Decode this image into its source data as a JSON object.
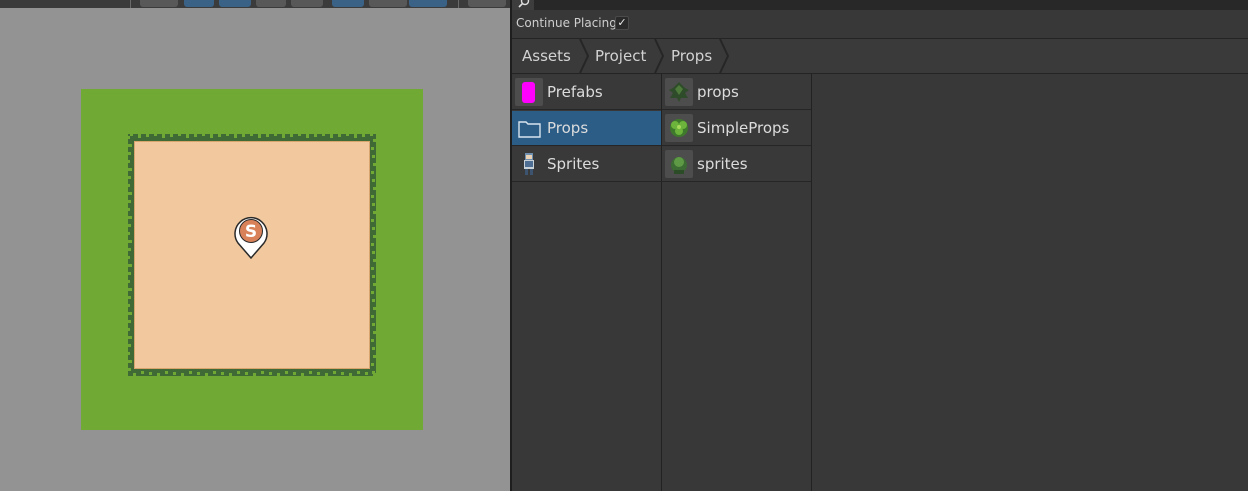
{
  "scene": {
    "toolbar_icons": [
      "globe-icon",
      "layers-icon",
      "move-tool-icon",
      "star-icon",
      "shape-icon",
      "chat-icon",
      "view-icon",
      "gizmo-icon",
      "settings-icon"
    ],
    "pin_letter": "S",
    "colors": {
      "background": "#939393",
      "grass": "#70a934",
      "sand": "#f2c99f",
      "border": "#3f6a35"
    }
  },
  "panel": {
    "search_icon": "search-icon",
    "continue_placing": {
      "label": "Continue Placing",
      "checked": true,
      "check_glyph": "✓"
    },
    "breadcrumb": [
      "Assets",
      "Project",
      "Props"
    ],
    "column1": [
      {
        "label": "Prefabs",
        "icon": "prefab-icon",
        "selected": false
      },
      {
        "label": "Props",
        "icon": "folder-icon",
        "selected": true
      },
      {
        "label": "Sprites",
        "icon": "character-sprite-icon",
        "selected": false
      }
    ],
    "column2": [
      {
        "label": "props",
        "icon": "tree-sprite-icon"
      },
      {
        "label": "SimpleProps",
        "icon": "bush-sprite-icon"
      },
      {
        "label": "sprites",
        "icon": "plant-sprite-icon"
      }
    ],
    "colors": {
      "selection": "#2c5d87",
      "prefab": "#ff00ff"
    }
  }
}
